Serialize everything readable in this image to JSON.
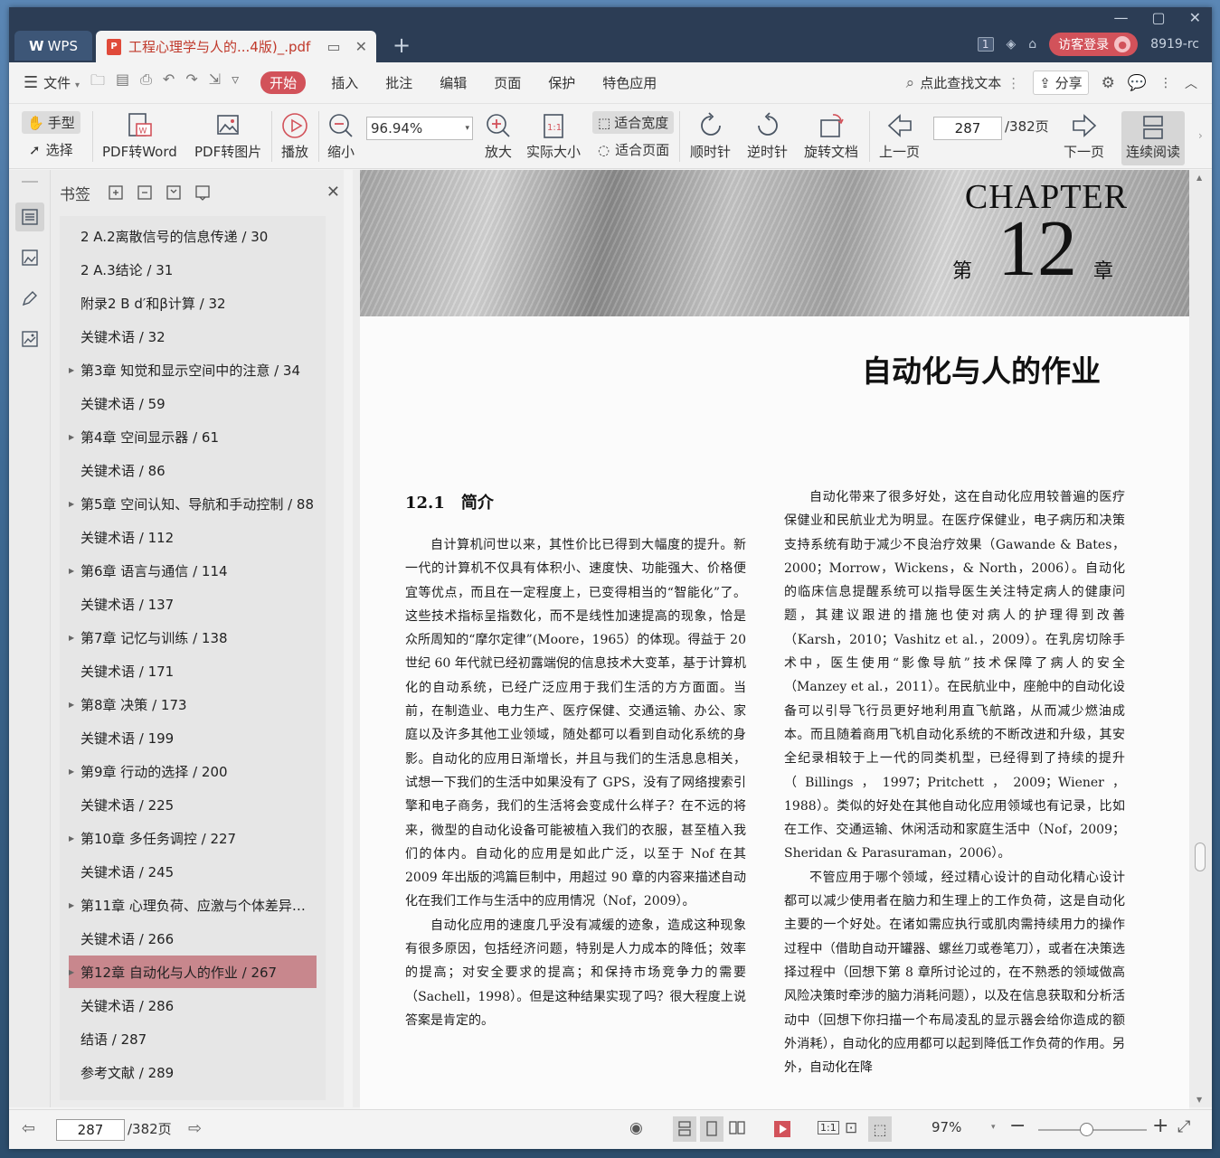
{
  "titlebar": {
    "app_tab": "WPS",
    "doc_tab": "工程心理学与人的...4版)_.pdf",
    "page_badge": "1",
    "login_label": "访客登录",
    "user_id": "8919-rc"
  },
  "menu": {
    "file": "文件",
    "tabs": [
      "开始",
      "插入",
      "批注",
      "编辑",
      "页面",
      "保护",
      "特色应用"
    ],
    "search": "点此查找文本",
    "share": "分享"
  },
  "toolbar": {
    "hand": "手型",
    "select": "选择",
    "pdf_to_word": "PDF转Word",
    "pdf_to_image": "PDF转图片",
    "play": "播放",
    "zoom_out": "缩小",
    "zoom_value": "96.94%",
    "zoom_in": "放大",
    "actual_size": "实际大小",
    "fit_width": "适合宽度",
    "fit_page": "适合页面",
    "clockwise": "顺时针",
    "counterclockwise": "逆时针",
    "rotate_doc": "旋转文档",
    "prev_page": "上一页",
    "current_page": "287",
    "total_pages": "/382页",
    "next_page": "下一页",
    "continuous": "连续阅读"
  },
  "bookmarks": {
    "title": "书签",
    "items": [
      {
        "label": "2 A.2离散信号的信息传递 / 30",
        "expand": false
      },
      {
        "label": "2 A.3结论 / 31",
        "expand": false
      },
      {
        "label": "附录2 B d′和β计算 / 32",
        "expand": false
      },
      {
        "label": "关键术语 / 32",
        "expand": false
      },
      {
        "label": "第3章 知觉和显示空间中的注意 / 34",
        "expand": true
      },
      {
        "label": "关键术语 / 59",
        "expand": false
      },
      {
        "label": "第4章 空间显示器 / 61",
        "expand": true
      },
      {
        "label": "关键术语 / 86",
        "expand": false
      },
      {
        "label": "第5章 空间认知、导航和手动控制 / 88",
        "expand": true
      },
      {
        "label": "关键术语 / 112",
        "expand": false
      },
      {
        "label": "第6章 语言与通信 / 114",
        "expand": true
      },
      {
        "label": "关键术语 / 137",
        "expand": false
      },
      {
        "label": "第7章 记忆与训练 / 138",
        "expand": true
      },
      {
        "label": "关键术语 / 171",
        "expand": false
      },
      {
        "label": "第8章 决策 / 173",
        "expand": true
      },
      {
        "label": "关键术语 / 199",
        "expand": false
      },
      {
        "label": "第9章 行动的选择 / 200",
        "expand": true
      },
      {
        "label": "关键术语 / 225",
        "expand": false
      },
      {
        "label": "第10章 多任务调控 / 227",
        "expand": true
      },
      {
        "label": "关键术语 / 245",
        "expand": false
      },
      {
        "label": "第11章 心理负荷、应激与个体差异：...",
        "expand": true
      },
      {
        "label": "关键术语 / 266",
        "expand": false
      },
      {
        "label": "第12章 自动化与人的作业 / 267",
        "expand": true,
        "selected": true
      },
      {
        "label": "关键术语 / 286",
        "expand": false
      },
      {
        "label": "结语 / 287",
        "expand": false
      },
      {
        "label": "参考文献 / 289",
        "expand": false
      }
    ]
  },
  "document": {
    "chapter_word": "CHAPTER",
    "chapter_di": "第",
    "chapter_num": "12",
    "chapter_zhang": "章",
    "chapter_title": "自动化与人的作业",
    "section_heading": "12.1　简介",
    "left_paragraphs": [
      "自计算机问世以来，其性价比已得到大幅度的提升。新一代的计算机不仅具有体积小、速度快、功能强大、价格便宜等优点，而且在一定程度上，已变得相当的“智能化”了。这些技术指标呈指数化，而不是线性加速提高的现象，恰是众所周知的“摩尔定律”(Moore，1965）的体现。得益于 20 世纪 60 年代就已经初露端倪的信息技术大变革，基于计算机化的自动系统，已经广泛应用于我们生活的方方面面。当前，在制造业、电力生产、医疗保健、交通运输、办公、家庭以及许多其他工业领域，随处都可以看到自动化系统的身影。自动化的应用日渐增长，并且与我们的生活息息相关，试想一下我们的生活中如果没有了 GPS，没有了网络搜索引擎和电子商务，我们的生活将会变成什么样子？在不远的将来，微型的自动化设备可能被植入我们的衣服，甚至植入我们的体内。自动化的应用是如此广泛，以至于 Nof 在其 2009 年出版的鸿篇巨制中，用超过 90 章的内容来描述自动化在我们工作与生活中的应用情况（Nof，2009）。",
      "自动化应用的速度几乎没有减缓的迹象，造成这种现象有很多原因，包括经济问题，特别是人力成本的降低；效率的提高；对安全要求的提高；和保持市场竞争力的需要（Sachell，1998）。但是这种结果实现了吗？很大程度上说答案是肯定的。"
    ],
    "right_paragraphs": [
      "自动化带来了很多好处，这在自动化应用较普遍的医疗保健业和民航业尤为明显。在医疗保健业，电子病历和决策支持系统有助于减少不良治疗效果（Gawande & Bates，2000；Morrow，Wickens，& North，2006）。自动化的临床信息提醒系统可以指导医生关注特定病人的健康问题，其建议跟进的措施也使对病人的护理得到改善（Karsh，2010；Vashitz et al.，2009）。在乳房切除手术中，医生使用“影像导航”技术保障了病人的安全（Manzey et al.，2011）。在民航业中，座舱中的自动化设备可以引导飞行员更好地利用直飞航路，从而减少燃油成本。而且随着商用飞机自动化系统的不断改进和升级，其安全纪录相较于上一代的同类机型，已经得到了持续的提升（Billings，1997；Pritchett，2009；Wiener，1988）。类似的好处在其他自动化应用领域也有记录，比如在工作、交通运输、休闲活动和家庭生活中（Nof，2009；Sheridan & Parasuraman，2006）。",
      "不管应用于哪个领域，经过精心设计的自动化精心设计都可以减少使用者在脑力和生理上的工作负荷，这是自动化主要的一个好处。在诸如需应执行或肌肉需持续用力的操作过程中（借助自动开罐器、螺丝刀或卷笔刀），或者在决策选择过程中（回想下第 8 章所讨论过的，在不熟悉的领域做高风险决策时牵涉的脑力消耗问题），以及在信息获取和分析活动中（回想下你扫描一个布局凌乱的显示器会给你造成的额外消耗），自动化的应用都可以起到降低工作负荷的作用。另外，自动化在降"
    ]
  },
  "statusbar": {
    "current_page": "287",
    "total_pages": "/382页",
    "zoom": "97%"
  },
  "colors": {
    "accent": "#d2525a",
    "titlebar": "#2c3d55",
    "selected_bookmark": "#c8878d"
  }
}
